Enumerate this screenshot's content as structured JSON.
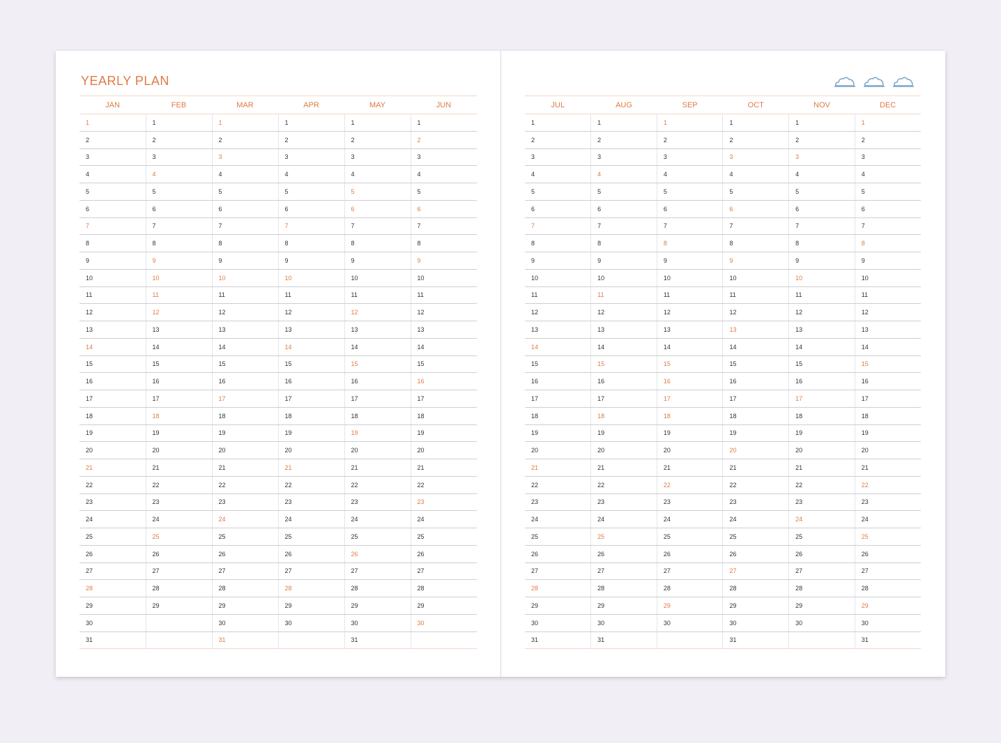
{
  "title": "YEARLY PLAN",
  "accent_color": "#e07a45",
  "cloud_color": "#7aa6c8",
  "clouds": [
    "cloud-icon",
    "cloud-icon",
    "cloud-icon"
  ],
  "left_months": [
    {
      "name": "JAN",
      "days": 31,
      "highlight": [
        1,
        7,
        14,
        21,
        28
      ]
    },
    {
      "name": "FEB",
      "days": 29,
      "highlight": [
        4,
        9,
        10,
        11,
        12,
        18,
        25
      ]
    },
    {
      "name": "MAR",
      "days": 31,
      "highlight": [
        1,
        3,
        10,
        17,
        24,
        31
      ]
    },
    {
      "name": "APR",
      "days": 30,
      "highlight": [
        7,
        10,
        14,
        21,
        28
      ]
    },
    {
      "name": "MAY",
      "days": 31,
      "highlight": [
        5,
        6,
        12,
        15,
        19,
        26
      ]
    },
    {
      "name": "JUN",
      "days": 30,
      "highlight": [
        2,
        6,
        9,
        16,
        23,
        30
      ]
    }
  ],
  "right_months": [
    {
      "name": "JUL",
      "days": 31,
      "highlight": [
        7,
        14,
        21,
        28
      ]
    },
    {
      "name": "AUG",
      "days": 31,
      "highlight": [
        4,
        11,
        15,
        18,
        25
      ]
    },
    {
      "name": "SEP",
      "days": 30,
      "highlight": [
        1,
        8,
        15,
        16,
        17,
        18,
        22,
        29
      ]
    },
    {
      "name": "OCT",
      "days": 31,
      "highlight": [
        3,
        6,
        9,
        13,
        20,
        27
      ]
    },
    {
      "name": "NOV",
      "days": 30,
      "highlight": [
        3,
        10,
        17,
        24
      ]
    },
    {
      "name": "DEC",
      "days": 31,
      "highlight": [
        1,
        8,
        15,
        22,
        25,
        29
      ]
    }
  ]
}
